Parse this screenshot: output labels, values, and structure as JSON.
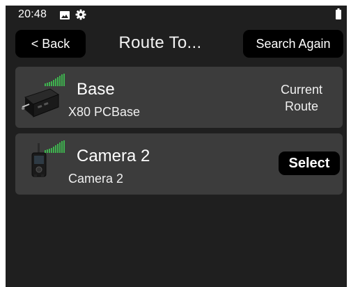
{
  "status_bar": {
    "time": "20:48",
    "icons": [
      "image-icon",
      "gear-icon",
      "battery-icon"
    ]
  },
  "header": {
    "back_label": "< Back",
    "title": "Route To...",
    "search_again_label": "Search Again"
  },
  "devices": [
    {
      "name": "Base",
      "model": "X80 PCBase",
      "status": "Current\nRoute",
      "status_line1": "Current",
      "status_line2": "Route",
      "icon": "base-station-icon",
      "signal_bars": 5
    },
    {
      "name": "Camera 2",
      "model": "Camera 2",
      "action_label": "Select",
      "icon": "camera-transmitter-icon",
      "signal_bars": 5
    }
  ],
  "colors": {
    "screen_bg": "#1f1f1f",
    "card_bg": "#3c3c3c",
    "button_bg": "#000000",
    "signal_green": "#3fb34f",
    "text": "#ffffff"
  }
}
